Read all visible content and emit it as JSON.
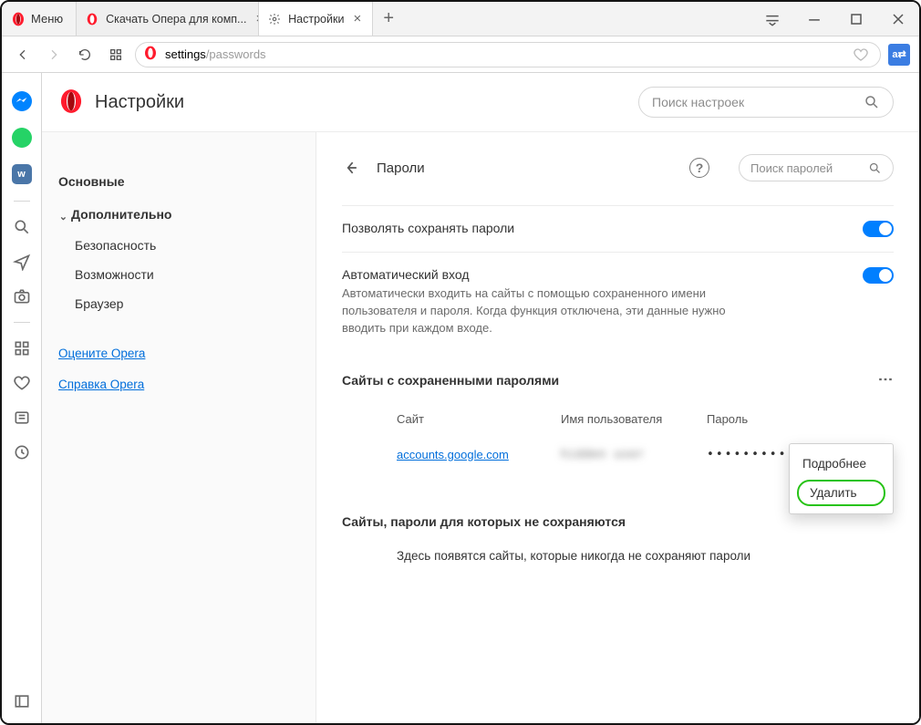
{
  "window": {
    "menu_label": "Меню",
    "tabs": [
      {
        "label": "Скачать Опера для комп..."
      },
      {
        "label": "Настройки"
      }
    ]
  },
  "toolbar": {
    "address_text": "settings",
    "address_path": "/passwords"
  },
  "mini_sidebar": {
    "vk_label": "w"
  },
  "settings": {
    "title": "Настройки",
    "search_placeholder": "Поиск настроек",
    "nav": {
      "basic": "Основные",
      "advanced": "Дополнительно",
      "security": "Безопасность",
      "features": "Возможности",
      "browser": "Браузер",
      "rate_link": "Оцените Opera",
      "help_link": "Справка Opera"
    },
    "passwords": {
      "section_title": "Пароли",
      "search_placeholder": "Поиск паролей",
      "offer_save_label": "Позволять сохранять пароли",
      "auto_signin_title": "Автоматический вход",
      "auto_signin_desc": "Автоматически входить на сайты с помощью сохраненного имени пользователя и пароля. Когда функция отключена, эти данные нужно вводить при каждом входе.",
      "saved_sites_title": "Сайты с сохраненными паролями",
      "col_site": "Сайт",
      "col_user": "Имя пользователя",
      "col_password": "Пароль",
      "row": {
        "site": "accounts.google.com",
        "user": "hidden user",
        "password_masked": "••••••••••"
      },
      "menu_details": "Подробнее",
      "menu_delete": "Удалить",
      "never_title": "Сайты, пароли для которых не сохраняются",
      "never_text": "Здесь появятся сайты, которые никогда не сохраняют пароли"
    }
  }
}
